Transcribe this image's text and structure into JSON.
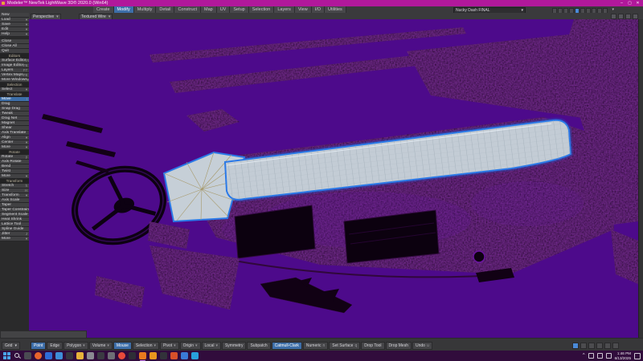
{
  "colors": {
    "titlebar": "#b1189b",
    "viewport_background": "#4d0a8b",
    "selection_outline_blue": "#2a79e8",
    "selection_surface": "#c3ccd5",
    "active_button_blue": "#3d6ea8",
    "taskbar_background": "#310c3c",
    "wireframe_dark": "#140118"
  },
  "icons": {
    "caret_down": "▾",
    "minimize": "–",
    "maximize": "▢",
    "close": "✕",
    "chevron_up": "^"
  },
  "titlebar": {
    "title": "Modeler™ NewTek LightWave 3D® 2020.0 (Win64)"
  },
  "menu": {
    "tabs": [
      "Create",
      "Modify",
      "Multiply",
      "Detail",
      "Construct",
      "Map",
      "UV",
      "Setup",
      "Selection",
      "Layers",
      "View",
      "I/O",
      "Utilities"
    ],
    "active_tab": "Modify"
  },
  "object_bar": {
    "object_name": "Nucky Dash FINAL",
    "layers": [
      "1",
      "2",
      "3",
      "4",
      "5",
      "6",
      "7",
      "8",
      "9",
      "10"
    ],
    "active_layer": "5"
  },
  "viewport_bar": {
    "view_mode": "Perspective",
    "render_mode": "Textured Wire"
  },
  "sidebar": {
    "sections": [
      {
        "header": null,
        "items": [
          {
            "label": "New"
          },
          {
            "label": "Load",
            "caret": true
          },
          {
            "label": "Save",
            "caret": true
          },
          {
            "label": "Edit",
            "caret": true
          },
          {
            "label": "Help",
            "caret": true
          }
        ]
      },
      {
        "header": null,
        "items": [
          {
            "label": "Close"
          },
          {
            "label": "Close All"
          },
          {
            "label": "Quit"
          }
        ]
      },
      {
        "header": "Editors",
        "items": [
          {
            "label": "Surface Editor",
            "hint": "F5"
          },
          {
            "label": "Image Editor",
            "hint": "F6"
          },
          {
            "label": "Layers",
            "hint": "F7"
          },
          {
            "label": "Vertex Maps",
            "hint": "F8"
          },
          {
            "label": "More Windows",
            "caret": true
          }
        ]
      },
      {
        "header": "Selection",
        "items": [
          {
            "label": "Select",
            "caret": true
          }
        ]
      },
      {
        "header": "Translate",
        "items": [
          {
            "label": "Move",
            "hint": "t",
            "active": true
          },
          {
            "label": "Drag"
          },
          {
            "label": "Snap Drag"
          },
          {
            "label": "Tweak"
          },
          {
            "label": "Drag Net"
          },
          {
            "label": "Magnet"
          },
          {
            "label": "Shear"
          },
          {
            "label": "Axis Translate"
          },
          {
            "label": "Align",
            "caret": true
          },
          {
            "label": "Center",
            "caret": true
          },
          {
            "label": "More",
            "caret": true
          }
        ]
      },
      {
        "header": "Rotate",
        "items": [
          {
            "label": "Rotate",
            "hint": "y"
          },
          {
            "label": "Axis Rotate"
          },
          {
            "label": "Bend"
          },
          {
            "label": "Twist"
          },
          {
            "label": "More",
            "caret": true
          }
        ]
      },
      {
        "header": "Transform",
        "items": [
          {
            "label": "Stretch",
            "hint": "h"
          },
          {
            "label": "Size",
            "hint": "H"
          },
          {
            "label": "Transform",
            "caret": true
          },
          {
            "label": "Axis Scale"
          },
          {
            "label": "Taper"
          },
          {
            "label": "Taper Constrain"
          },
          {
            "label": "Segment Scale"
          },
          {
            "label": "Heat Shrink"
          },
          {
            "label": "Lattice Tool"
          },
          {
            "label": "Spline Guide"
          },
          {
            "label": "Jitter",
            "hint": "J"
          },
          {
            "label": "More",
            "caret": true
          }
        ]
      }
    ]
  },
  "bottom_toolbar": {
    "grid": {
      "label": "Grid"
    },
    "buttons": [
      {
        "label": "Point",
        "active": true
      },
      {
        "label": "Edge"
      },
      {
        "label": "Polygon",
        "caret": true
      },
      {
        "label": "Volume",
        "caret": true
      },
      {
        "label": "Mouse",
        "active": true
      },
      {
        "label": "Selection",
        "caret": true
      },
      {
        "label": "Pivot",
        "caret": true
      },
      {
        "label": "Origin",
        "caret": true
      },
      {
        "label": "Local",
        "caret": true
      },
      {
        "label": "Symmetry"
      },
      {
        "label": "Subpatch"
      },
      {
        "label": "Catmull-Clark",
        "active": true
      },
      {
        "label": "Numeric",
        "hint": "n"
      },
      {
        "label": "Set Surface",
        "hint": "q"
      },
      {
        "label": "Drop Tool"
      },
      {
        "label": "Drop Mesh"
      },
      {
        "label": "Undo",
        "hint": "u"
      }
    ]
  },
  "taskbar": {
    "apps": [
      {
        "name": "start",
        "shape": "win",
        "color": "#4aa3e8"
      },
      {
        "name": "search",
        "shape": "search",
        "color": "#d6d6dc"
      },
      {
        "name": "task-view",
        "shape": "square",
        "color": "#4a4a52"
      },
      {
        "name": "app-browser",
        "shape": "circle",
        "color": "#e8642c"
      },
      {
        "name": "app-blue-1",
        "shape": "square",
        "color": "#2e6cd6"
      },
      {
        "name": "app-photos",
        "shape": "square",
        "color": "#3e8ed8"
      },
      {
        "name": "app-camera",
        "shape": "square",
        "color": "#36363e"
      },
      {
        "name": "file-explorer",
        "shape": "square",
        "color": "#e8b33a"
      },
      {
        "name": "app-tools",
        "shape": "square",
        "color": "#8a8a92"
      },
      {
        "name": "app-dark-1",
        "shape": "square",
        "color": "#3a3a42"
      },
      {
        "name": "app-gray-1",
        "shape": "square",
        "color": "#6e6e76"
      },
      {
        "name": "app-chrome",
        "shape": "circle",
        "color": "#e84a3a"
      },
      {
        "name": "app-dark-2",
        "shape": "square",
        "color": "#2e2e36"
      },
      {
        "name": "lightwave-modeler",
        "shape": "square",
        "color": "#e87a1e",
        "active": true
      },
      {
        "name": "lightwave-layout",
        "shape": "square",
        "color": "#e8961e"
      },
      {
        "name": "app-dark-3",
        "shape": "square",
        "color": "#32323a"
      },
      {
        "name": "app-red-1",
        "shape": "square",
        "color": "#d8502a"
      },
      {
        "name": "app-blue-2",
        "shape": "square",
        "color": "#3a7ad8"
      },
      {
        "name": "app-cyan-1",
        "shape": "square",
        "color": "#28a0dc"
      }
    ],
    "tray": {
      "time": "1:46 PM",
      "date": "6/13/2025"
    }
  }
}
